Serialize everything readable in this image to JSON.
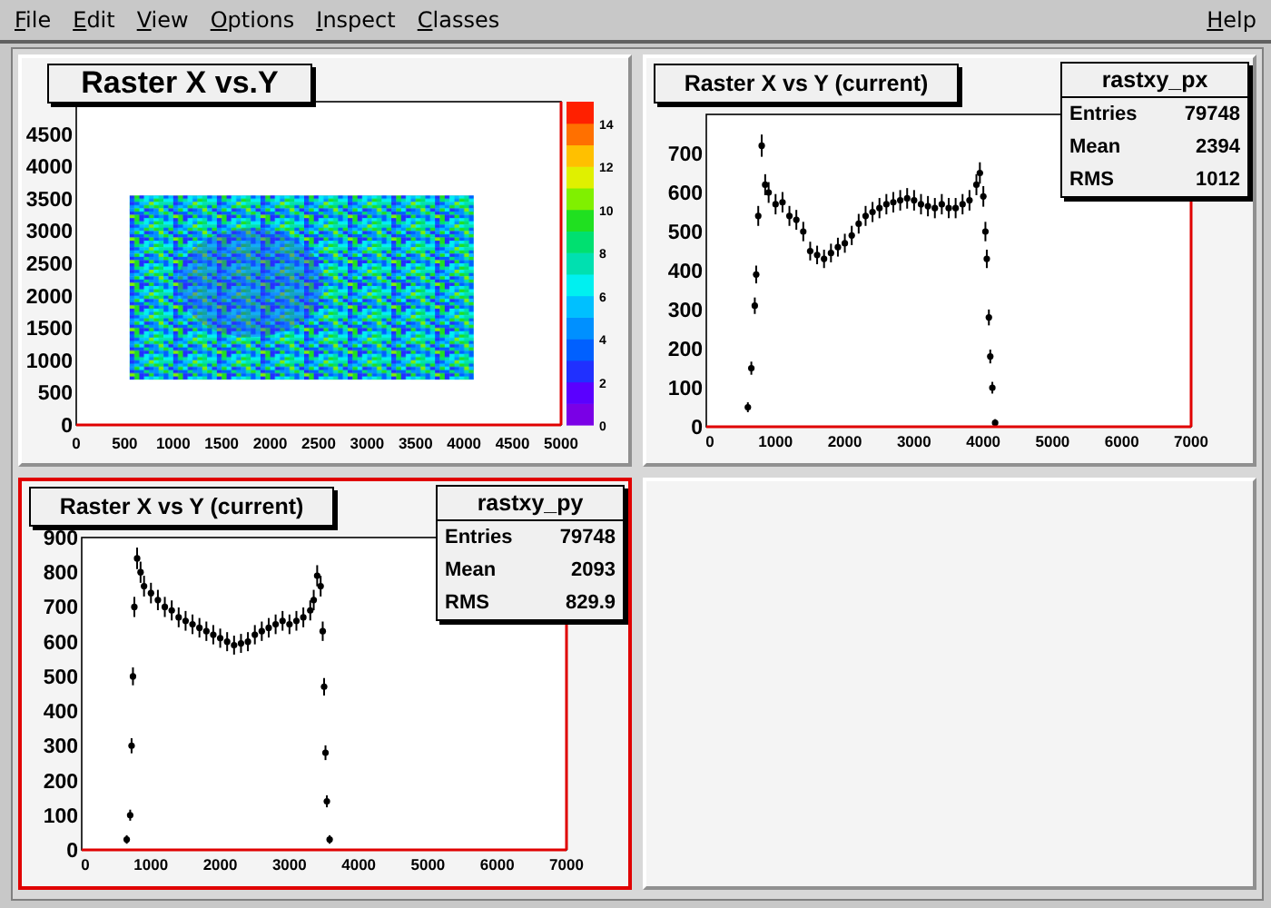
{
  "menu": {
    "items": [
      "File",
      "Edit",
      "View",
      "Options",
      "Inspect",
      "Classes"
    ],
    "help": "Help"
  },
  "pads": [
    {
      "kind": "map",
      "selected": false,
      "title": "Raster X vs.Y",
      "xticks": [
        "0",
        "500",
        "1000",
        "1500",
        "2000",
        "2500",
        "3000",
        "3500",
        "4000",
        "4500",
        "5000"
      ],
      "yticks": [
        "4500",
        "4000",
        "3500",
        "3000",
        "2500",
        "2000",
        "1500",
        "1000",
        "500",
        "0"
      ],
      "scale_ticks": [
        "14",
        "12",
        "10",
        "8",
        "6",
        "4",
        "2",
        "0"
      ]
    },
    {
      "kind": "hist",
      "selected": false,
      "title": "Raster X vs Y (current)",
      "stats": {
        "name": "rastxy_px",
        "rows": [
          {
            "label": "Entries",
            "value": "79748"
          },
          {
            "label": "Mean",
            "value": "2394"
          },
          {
            "label": "RMS",
            "value": "1012"
          }
        ]
      },
      "chart_data": {
        "type": "scatter",
        "xlim": [
          0,
          7000
        ],
        "ylim": [
          0,
          800
        ],
        "xticks": [
          0,
          1000,
          2000,
          3000,
          4000,
          5000,
          6000,
          7000
        ],
        "yticks": [
          0,
          100,
          200,
          300,
          400,
          500,
          600,
          700
        ],
        "x": [
          600,
          650,
          700,
          720,
          750,
          800,
          850,
          900,
          1000,
          1100,
          1200,
          1300,
          1400,
          1500,
          1600,
          1700,
          1800,
          1900,
          2000,
          2100,
          2200,
          2300,
          2400,
          2500,
          2600,
          2700,
          2800,
          2900,
          3000,
          3100,
          3200,
          3300,
          3400,
          3500,
          3600,
          3700,
          3800,
          3900,
          3950,
          4000,
          4030,
          4050,
          4080,
          4100,
          4130,
          4170
        ],
        "series": [
          {
            "color": "#000000",
            "values": [
              50,
              150,
              310,
              390,
              540,
              720,
              620,
              600,
              570,
              575,
              540,
              530,
              500,
              450,
              440,
              430,
              445,
              460,
              470,
              490,
              520,
              540,
              550,
              560,
              570,
              575,
              580,
              585,
              580,
              570,
              565,
              560,
              570,
              560,
              560,
              570,
              580,
              620,
              650,
              590,
              500,
              430,
              280,
              180,
              100,
              10
            ]
          }
        ]
      }
    },
    {
      "kind": "hist",
      "selected": true,
      "title": "Raster X vs Y (current)",
      "stats": {
        "name": "rastxy_py",
        "rows": [
          {
            "label": "Entries",
            "value": "79748"
          },
          {
            "label": "Mean",
            "value": "2093"
          },
          {
            "label": "RMS",
            "value": "829.9"
          }
        ]
      },
      "chart_data": {
        "type": "scatter",
        "xlim": [
          0,
          7000
        ],
        "ylim": [
          0,
          900
        ],
        "xticks": [
          0,
          1000,
          2000,
          3000,
          4000,
          5000,
          6000,
          7000
        ],
        "yticks": [
          0,
          100,
          200,
          300,
          400,
          500,
          600,
          700,
          800,
          900
        ],
        "x": [
          650,
          700,
          720,
          740,
          760,
          800,
          850,
          900,
          1000,
          1100,
          1200,
          1300,
          1400,
          1500,
          1600,
          1700,
          1800,
          1900,
          2000,
          2100,
          2200,
          2300,
          2400,
          2500,
          2600,
          2700,
          2800,
          2900,
          3000,
          3100,
          3200,
          3300,
          3350,
          3400,
          3450,
          3480,
          3500,
          3520,
          3540,
          3580
        ],
        "series": [
          {
            "color": "#000000",
            "values": [
              30,
              100,
              300,
              500,
              700,
              840,
              800,
              760,
              740,
              720,
              700,
              690,
              670,
              660,
              650,
              640,
              630,
              620,
              610,
              600,
              590,
              595,
              600,
              620,
              630,
              640,
              650,
              660,
              650,
              660,
              670,
              690,
              720,
              790,
              760,
              630,
              470,
              280,
              140,
              30
            ]
          }
        ]
      }
    },
    {
      "kind": "empty",
      "selected": false
    }
  ]
}
